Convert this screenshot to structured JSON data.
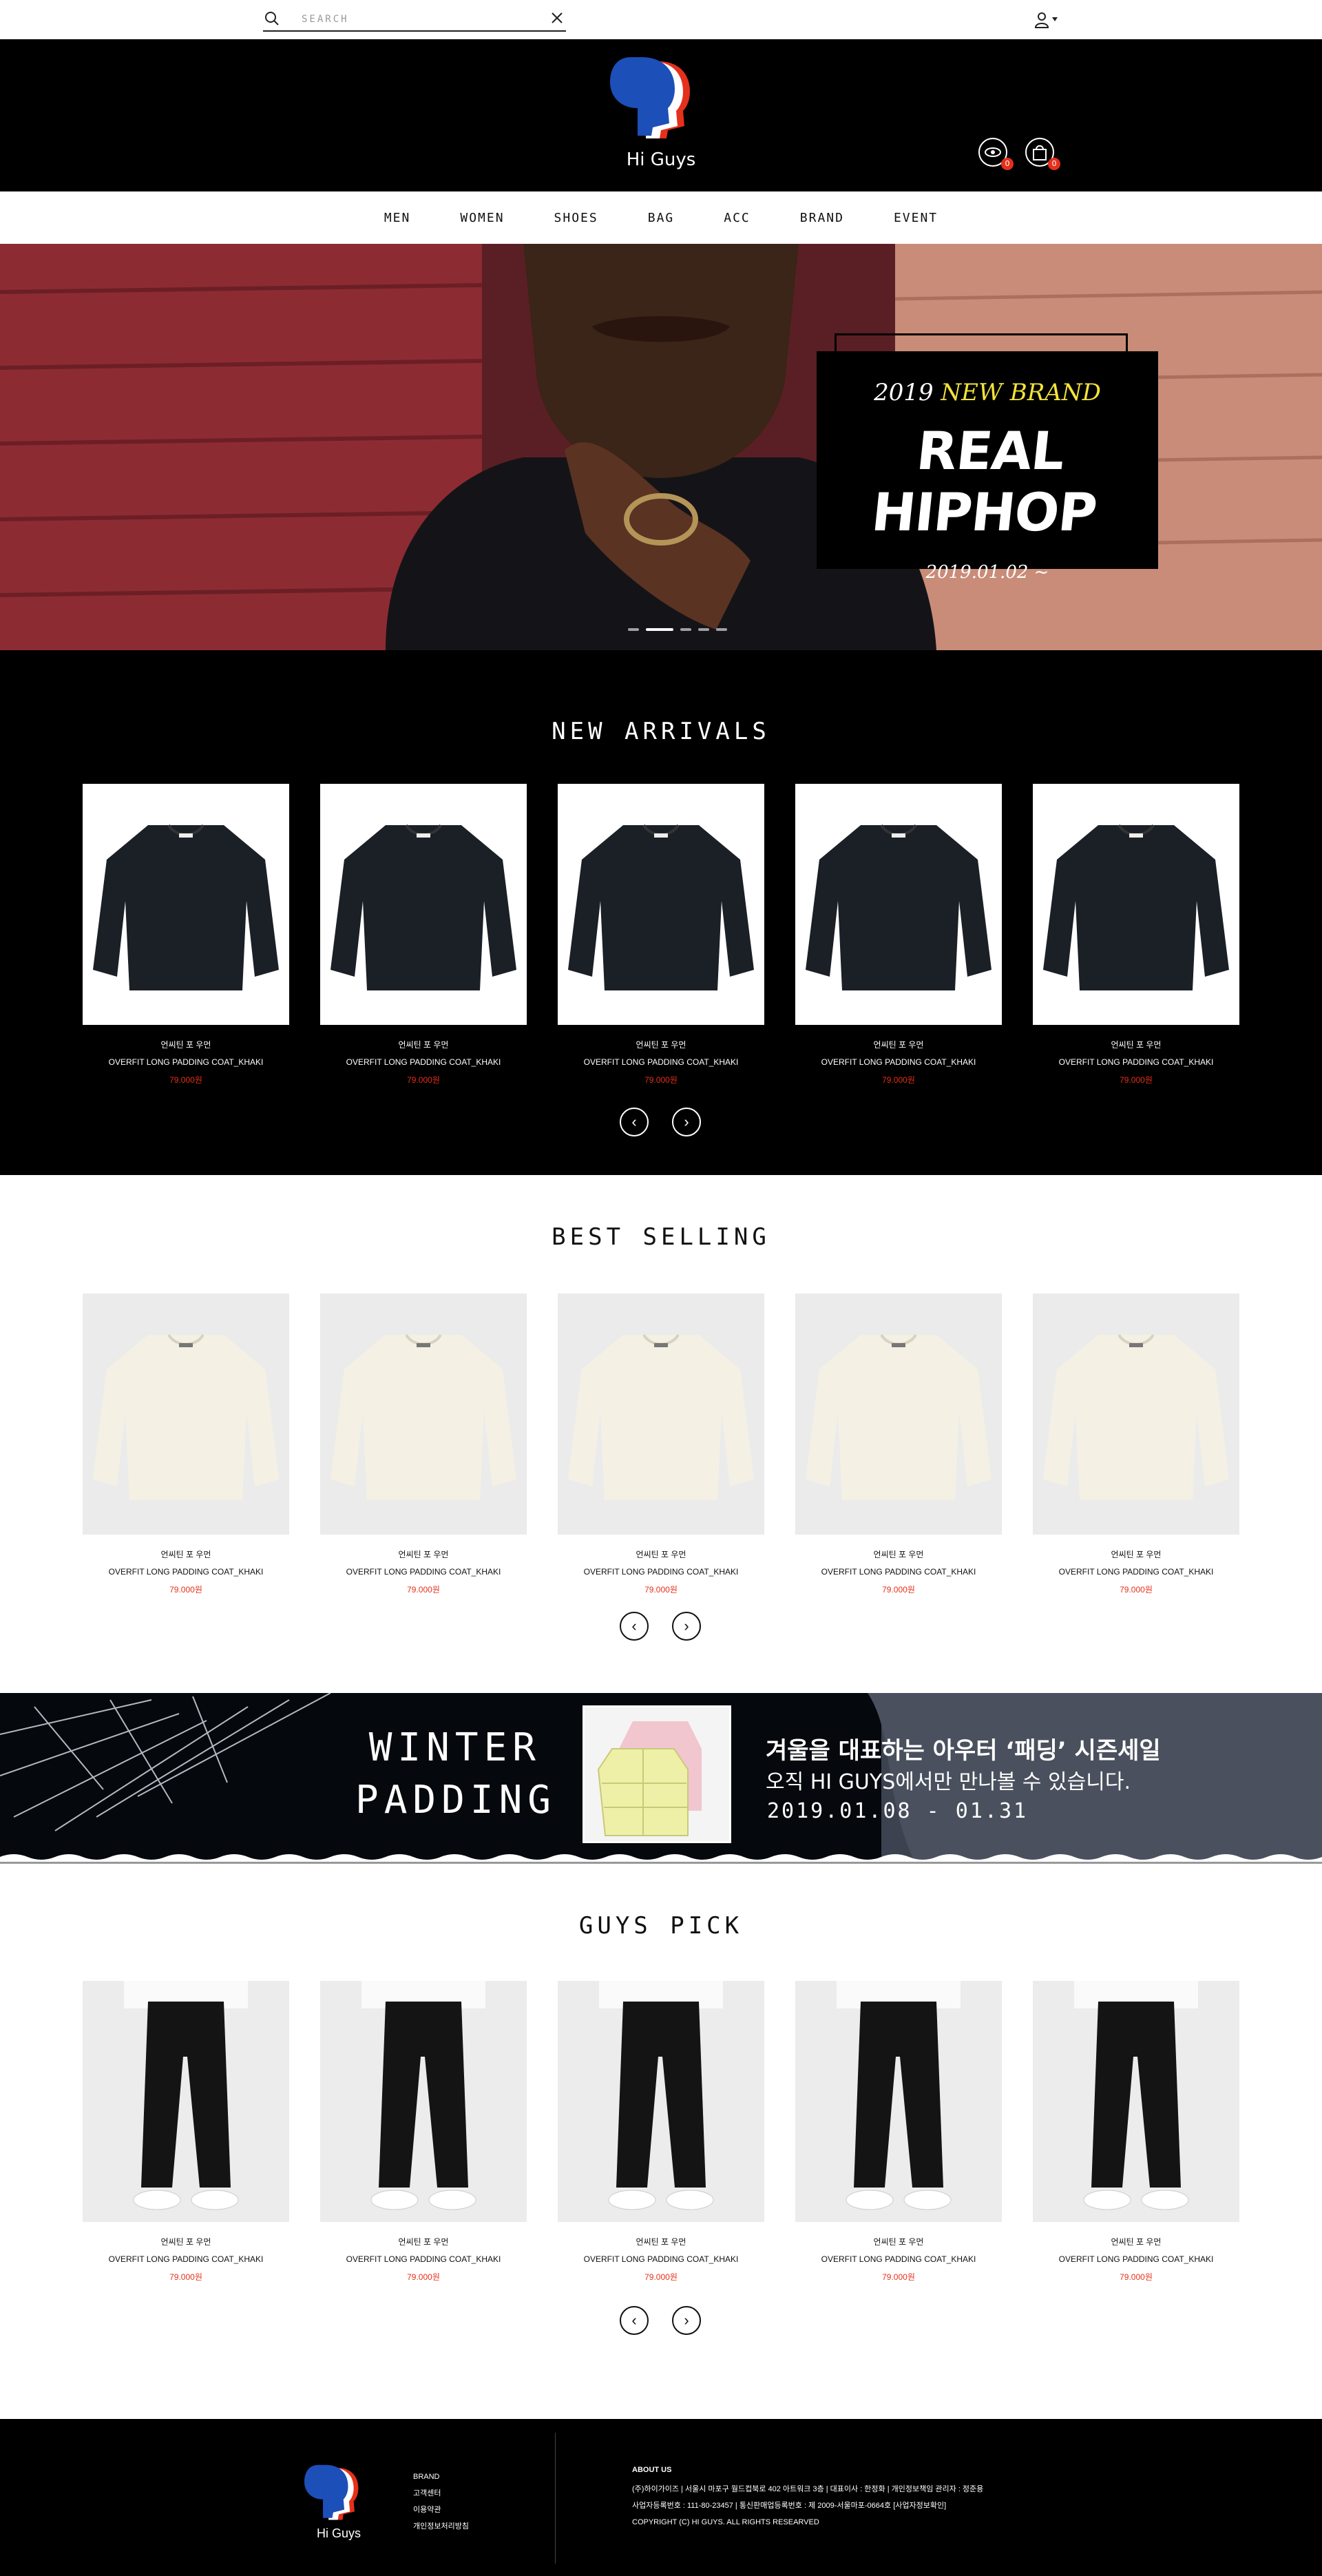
{
  "search": {
    "placeholder": "SEARCH"
  },
  "brand": {
    "name": "Hi Guys"
  },
  "header": {
    "view_count": "0",
    "cart_count": "0"
  },
  "nav": [
    "MEN",
    "WOMEN",
    "SHOES",
    "BAG",
    "ACC",
    "BRAND",
    "EVENT"
  ],
  "hero": {
    "year": "2019",
    "accent": "NEW BRAND",
    "title": "REAL HIPHOP",
    "date": "2019.01.02 ~"
  },
  "sections": [
    {
      "title": "NEW ARRIVALS",
      "product_type": "black-sweatshirt",
      "products": [
        {
          "name_ko": "언씨틴 포 우먼",
          "name_en": "OVERFIT LONG PADDING COAT_KHAKI",
          "price": "79.000원"
        },
        {
          "name_ko": "언씨틴 포 우먼",
          "name_en": "OVERFIT LONG PADDING COAT_KHAKI",
          "price": "79.000원"
        },
        {
          "name_ko": "언씨틴 포 우먼",
          "name_en": "OVERFIT LONG PADDING COAT_KHAKI",
          "price": "79.000원"
        },
        {
          "name_ko": "언씨틴 포 우먼",
          "name_en": "OVERFIT LONG PADDING COAT_KHAKI",
          "price": "79.000원"
        },
        {
          "name_ko": "언씨틴 포 우먼",
          "name_en": "OVERFIT LONG PADDING COAT_KHAKI",
          "price": "79.000원"
        }
      ]
    },
    {
      "title": "BEST SELLING",
      "product_type": "cream-sweatshirt",
      "products": [
        {
          "name_ko": "언씨틴 포 우먼",
          "name_en": "OVERFIT LONG PADDING COAT_KHAKI",
          "price": "79.000원"
        },
        {
          "name_ko": "언씨틴 포 우먼",
          "name_en": "OVERFIT LONG PADDING COAT_KHAKI",
          "price": "79.000원"
        },
        {
          "name_ko": "언씨틴 포 우먼",
          "name_en": "OVERFIT LONG PADDING COAT_KHAKI",
          "price": "79.000원"
        },
        {
          "name_ko": "언씨틴 포 우먼",
          "name_en": "OVERFIT LONG PADDING COAT_KHAKI",
          "price": "79.000원"
        },
        {
          "name_ko": "언씨틴 포 우먼",
          "name_en": "OVERFIT LONG PADDING COAT_KHAKI",
          "price": "79.000원"
        }
      ]
    },
    {
      "title": "GUYS PICK",
      "product_type": "black-pants",
      "products": [
        {
          "name_ko": "언씨틴 포 우먼",
          "name_en": "OVERFIT LONG PADDING COAT_KHAKI",
          "price": "79.000원"
        },
        {
          "name_ko": "언씨틴 포 우먼",
          "name_en": "OVERFIT LONG PADDING COAT_KHAKI",
          "price": "79.000원"
        },
        {
          "name_ko": "언씨틴 포 우먼",
          "name_en": "OVERFIT LONG PADDING COAT_KHAKI",
          "price": "79.000원"
        },
        {
          "name_ko": "언씨틴 포 우먼",
          "name_en": "OVERFIT LONG PADDING COAT_KHAKI",
          "price": "79.000원"
        },
        {
          "name_ko": "언씨틴 포 우먼",
          "name_en": "OVERFIT LONG PADDING COAT_KHAKI",
          "price": "79.000원"
        }
      ]
    }
  ],
  "winter": {
    "headline1": "WINTER",
    "headline2": "PADDING",
    "line1": "겨울을 대표하는 아우터 ‘패딩’ 시즌세일",
    "line2": "오직 HI GUYS에서만 만나볼 수 있습니다.",
    "line3": "2019.01.08 - 01.31"
  },
  "footer": {
    "links": [
      "BRAND",
      "고객센터",
      "이용약관",
      "개인정보처리방침"
    ],
    "about_title": "ABOUT US",
    "info1": "(주)하이가이즈  |  서울시 마포구 월드컵북로 402 아트워크 3층  |  대표이사 : 한정화  |  개인정보책임 관리자 : 정준용",
    "info2": "사업자등록번호 : 111-80-23457  |  통신판매업등록번호 : 제 2009-서울마포-0664호 [사업자정보확인]",
    "copyright": "COPYRIGHT (C) HI GUYS. ALL RIGHTS RESEARVED"
  },
  "colors": {
    "accent": "#e5301b",
    "highlight": "#f3e33a",
    "dark": "#000000"
  },
  "icons": [
    "search-icon",
    "close-icon",
    "user-icon",
    "eye-icon",
    "cart-icon",
    "chevron-left-icon",
    "chevron-right-icon"
  ]
}
